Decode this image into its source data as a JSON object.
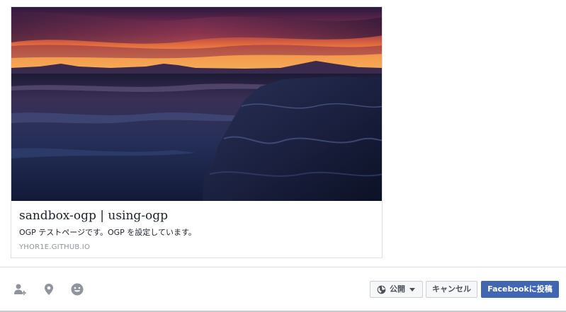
{
  "link_preview": {
    "title": "sandbox-ogp | using-ogp",
    "description": "OGP テストページです。OGP を設定しています。",
    "domain": "YHOR1E.GITHUB.IO",
    "image_description": "sunset over frozen sea with cliff"
  },
  "composer_tools": [
    {
      "icon": "tag-friends-icon"
    },
    {
      "icon": "location-pin-icon"
    },
    {
      "icon": "feeling-smiley-icon"
    }
  ],
  "actions": {
    "privacy_label": "公開",
    "privacy_icon": "globe-icon",
    "cancel_label": "キャンセル",
    "post_label": "Facebookに投稿"
  },
  "colors": {
    "primary": "#4267b2",
    "secondary_bg": "#f6f7f9",
    "border": "#dddfe2",
    "text": "#1d2129",
    "muted": "#90949c",
    "icon": "#90949c"
  }
}
